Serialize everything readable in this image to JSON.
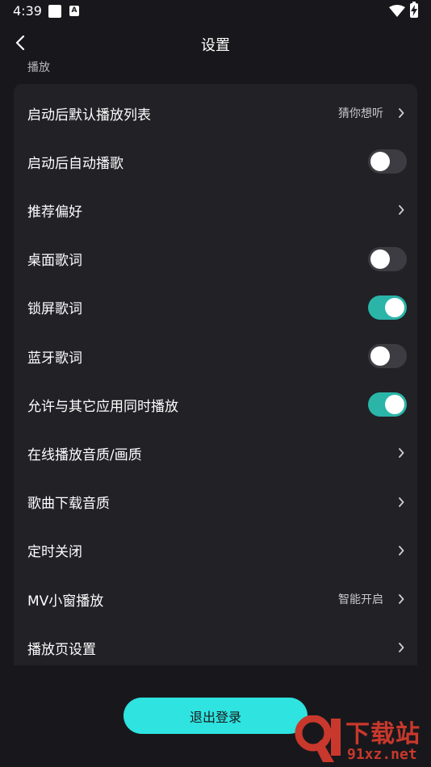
{
  "status_bar": {
    "time": "4:39",
    "badge_letter": "A"
  },
  "header": {
    "title": "设置"
  },
  "section": {
    "label": "播放"
  },
  "settings": [
    {
      "label": "启动后默认播放列表",
      "value": "猜你想听",
      "control": "chevron"
    },
    {
      "label": "启动后自动播歌",
      "control": "toggle",
      "on": false
    },
    {
      "label": "推荐偏好",
      "control": "chevron"
    },
    {
      "label": "桌面歌词",
      "control": "toggle",
      "on": false
    },
    {
      "label": "锁屏歌词",
      "control": "toggle",
      "on": true
    },
    {
      "label": "蓝牙歌词",
      "control": "toggle",
      "on": false
    },
    {
      "label": "允许与其它应用同时播放",
      "control": "toggle",
      "on": true
    },
    {
      "label": "在线播放音质/画质",
      "control": "chevron"
    },
    {
      "label": "歌曲下载音质",
      "control": "chevron"
    },
    {
      "label": "定时关闭",
      "control": "chevron"
    },
    {
      "label": "MV小窗播放",
      "value": "智能开启",
      "control": "chevron"
    },
    {
      "label": "播放页设置",
      "control": "chevron"
    }
  ],
  "logout": {
    "label": "退出登录"
  },
  "watermark": {
    "brand": "下载站",
    "url": "91xz.net"
  },
  "colors": {
    "background": "#18181c",
    "card": "#212126",
    "toggle_on": "#2ab5a8",
    "toggle_off": "#3c3c42",
    "logout_button": "#2ee3e0",
    "watermark": "#c9382c"
  }
}
